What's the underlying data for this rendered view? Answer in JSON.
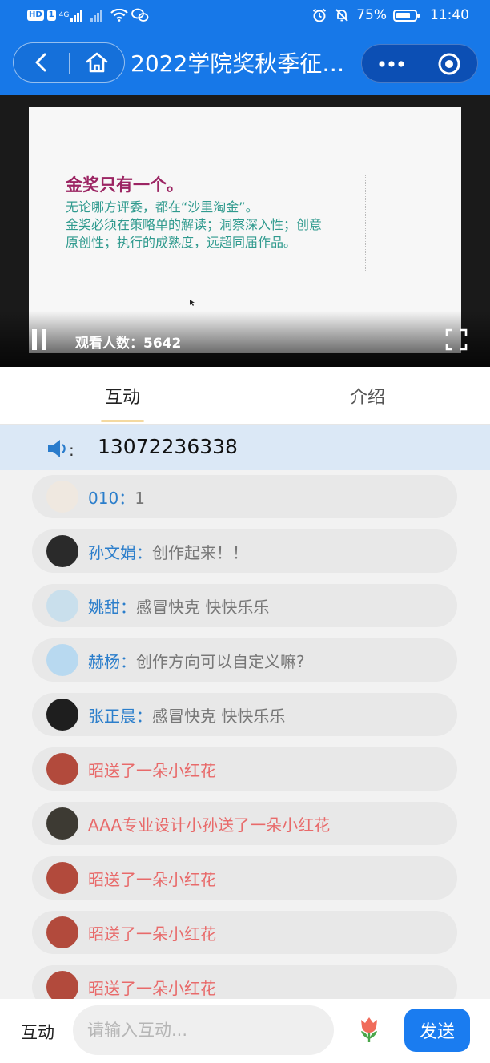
{
  "status_bar": {
    "hd_badge": "HD",
    "sim_badge": "1",
    "network": "4G",
    "battery": "75%",
    "battery_level": 0.75,
    "time": "11:40"
  },
  "nav": {
    "title": "2022学院奖秋季征…",
    "back_icon": "chevron-left-icon",
    "home_icon": "home-icon",
    "more_icon": "more-dots-icon",
    "close_icon": "target-icon"
  },
  "video": {
    "slide": {
      "title": "金奖只有一个。",
      "lines": [
        "无论哪方评委，都在“沙里淘金”。",
        "金奖必须在策略单的解读；洞察深入性；创意",
        "原创性；执行的成熟度，远超同届作品。"
      ]
    },
    "viewer_label": "观看人数：5642"
  },
  "tabs": [
    {
      "label": "互动",
      "active": true
    },
    {
      "label": "介绍",
      "active": false
    }
  ],
  "notice": {
    "icon": "speaker-icon",
    "text": "13072236338"
  },
  "chat": {
    "messages": [
      {
        "type": "comment",
        "name": "010",
        "text": "1",
        "avatar_color": "#efe8e0"
      },
      {
        "type": "comment",
        "name": "孙文娟",
        "text": "创作起来！！",
        "avatar_color": "#2a2a2a"
      },
      {
        "type": "comment",
        "name": "姚甜",
        "text": "感冒快克 快快乐乐",
        "avatar_color": "#c9dfec"
      },
      {
        "type": "comment",
        "name": "赫杨",
        "text": "创作方向可以自定义嘛?",
        "avatar_color": "#b8d9f0"
      },
      {
        "type": "comment",
        "name": "张正晨",
        "text": "感冒快克 快快乐乐",
        "avatar_color": "#1e1e1e"
      },
      {
        "type": "gift",
        "text": "昭送了一朵小红花",
        "avatar_color": "#b24a3c"
      },
      {
        "type": "gift",
        "text": "AAA专业设计小孙送了一朵小红花",
        "avatar_color": "#3d3a33"
      },
      {
        "type": "gift",
        "text": "昭送了一朵小红花",
        "avatar_color": "#b24a3c"
      },
      {
        "type": "gift",
        "text": "昭送了一朵小红花",
        "avatar_color": "#b24a3c"
      },
      {
        "type": "gift",
        "text": "昭送了一朵小红花",
        "avatar_color": "#b24a3c"
      }
    ]
  },
  "bottom": {
    "label": "互动",
    "placeholder": "请输入互动...",
    "flower_icon": "tulip-icon",
    "send_label": "发送"
  },
  "colors": {
    "header": "#1778e8",
    "name_blue": "#2b7ecb",
    "gift_red": "#e86a6a",
    "send_button": "#1a7cf0",
    "slide_title": "#9c2563",
    "slide_text": "#2f9a8e"
  }
}
